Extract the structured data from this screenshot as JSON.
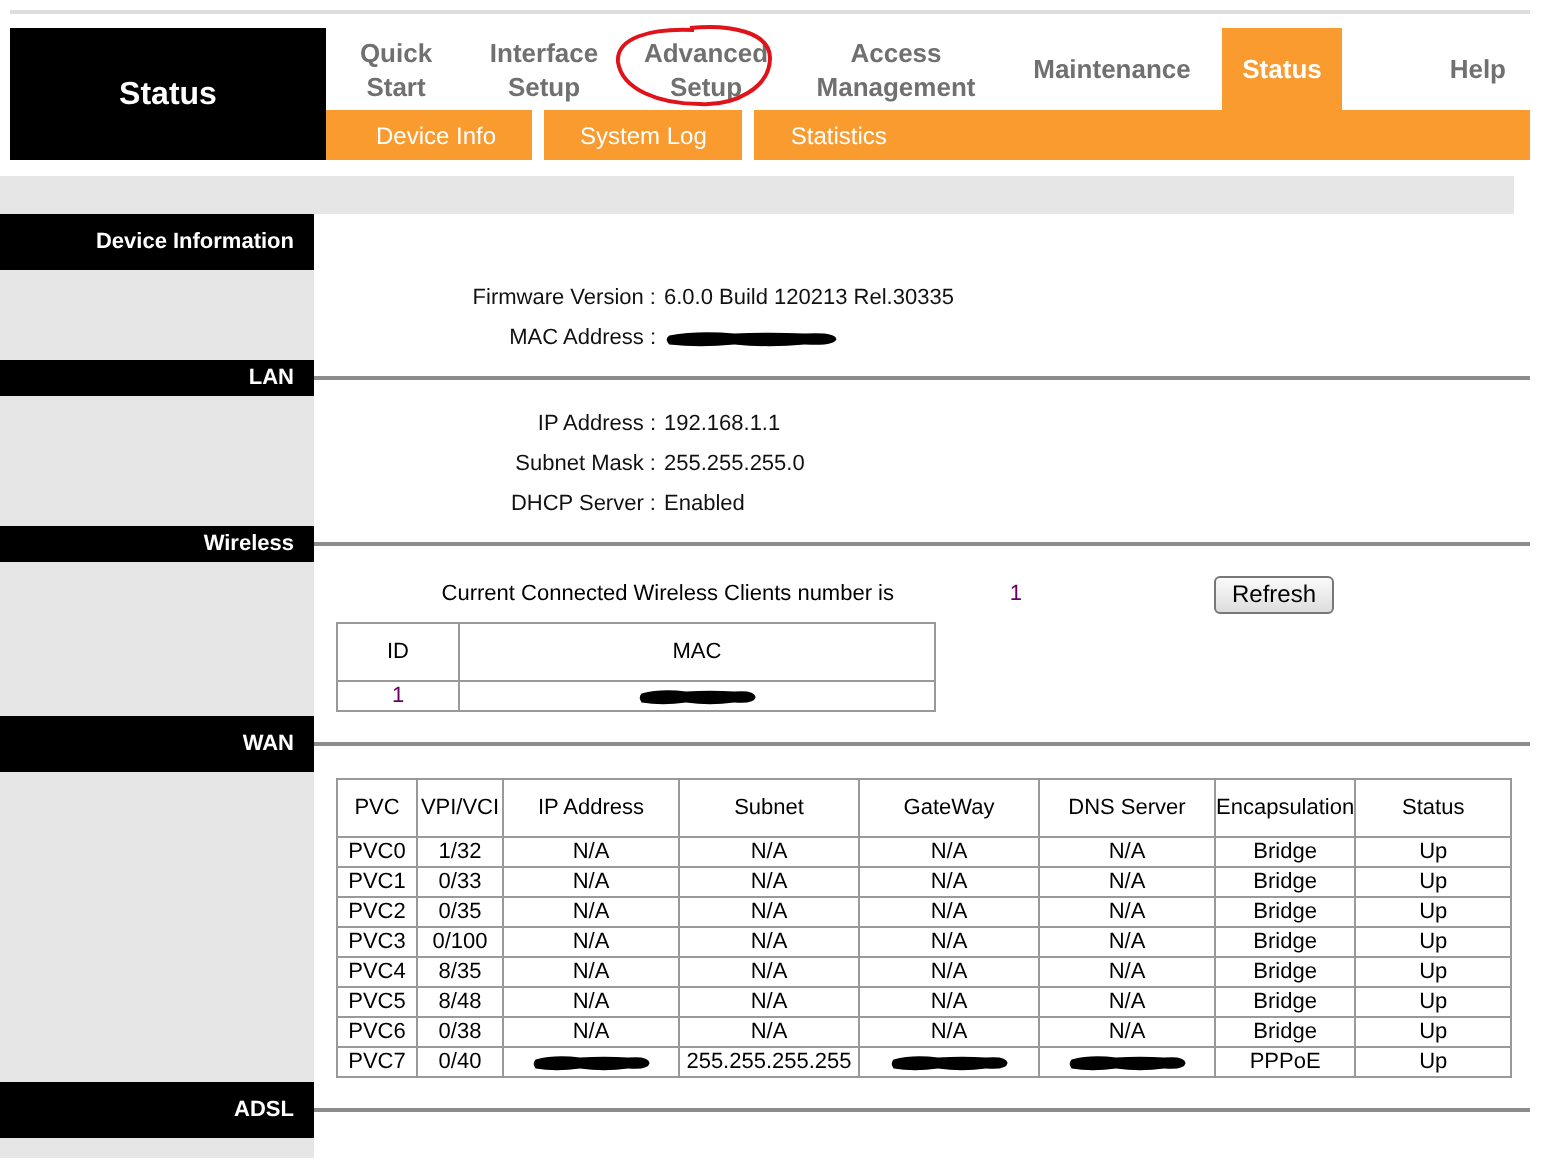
{
  "header": {
    "title": "Status",
    "nav": [
      {
        "label": "Quick Start",
        "selected": false,
        "annotated": false
      },
      {
        "label": "Interface Setup",
        "selected": false,
        "annotated": false
      },
      {
        "label": "Advanced Setup",
        "selected": false,
        "annotated": true
      },
      {
        "label": "Access Management",
        "selected": false,
        "annotated": false
      },
      {
        "label": "Maintenance",
        "selected": false,
        "annotated": false
      },
      {
        "label": "Status",
        "selected": true,
        "annotated": false
      },
      {
        "label": "Help",
        "selected": false,
        "annotated": false
      }
    ],
    "subnav": [
      {
        "label": "Device Info"
      },
      {
        "label": "System Log"
      },
      {
        "label": "Statistics"
      }
    ]
  },
  "sections": [
    {
      "title": "Device Information",
      "kind": "info",
      "rows": [
        {
          "label": "Firmware Version :",
          "value": "6.0.0 Build 120213 Rel.30335"
        },
        {
          "label": "MAC Address :",
          "redacted": true
        }
      ]
    },
    {
      "title": "LAN",
      "kind": "info",
      "rows": [
        {
          "label": "IP Address :",
          "value": "192.168.1.1"
        },
        {
          "label": "Subnet Mask :",
          "value": "255.255.255.0"
        },
        {
          "label": "DHCP Server :",
          "value": "Enabled"
        }
      ]
    },
    {
      "title": "Wireless",
      "kind": "clients",
      "caption": "Current Connected Wireless Clients number is",
      "count": "1",
      "button": "Refresh",
      "columns": [
        "ID",
        "MAC"
      ],
      "rows": [
        [
          {
            "text": "1"
          },
          {
            "redacted": true
          }
        ]
      ]
    },
    {
      "title": "WAN",
      "kind": "table",
      "columns": [
        "PVC",
        "VPI/VCI",
        "IP Address",
        "Subnet",
        "GateWay",
        "DNS Server",
        "Encapsulation",
        "Status"
      ],
      "rows": [
        [
          {
            "text": "PVC0"
          },
          {
            "text": "1/32"
          },
          {
            "text": "N/A"
          },
          {
            "text": "N/A"
          },
          {
            "text": "N/A"
          },
          {
            "text": "N/A"
          },
          {
            "text": "Bridge"
          },
          {
            "text": "Up"
          }
        ],
        [
          {
            "text": "PVC1"
          },
          {
            "text": "0/33"
          },
          {
            "text": "N/A"
          },
          {
            "text": "N/A"
          },
          {
            "text": "N/A"
          },
          {
            "text": "N/A"
          },
          {
            "text": "Bridge"
          },
          {
            "text": "Up"
          }
        ],
        [
          {
            "text": "PVC2"
          },
          {
            "text": "0/35"
          },
          {
            "text": "N/A"
          },
          {
            "text": "N/A"
          },
          {
            "text": "N/A"
          },
          {
            "text": "N/A"
          },
          {
            "text": "Bridge"
          },
          {
            "text": "Up"
          }
        ],
        [
          {
            "text": "PVC3"
          },
          {
            "text": "0/100"
          },
          {
            "text": "N/A"
          },
          {
            "text": "N/A"
          },
          {
            "text": "N/A"
          },
          {
            "text": "N/A"
          },
          {
            "text": "Bridge"
          },
          {
            "text": "Up"
          }
        ],
        [
          {
            "text": "PVC4"
          },
          {
            "text": "8/35"
          },
          {
            "text": "N/A"
          },
          {
            "text": "N/A"
          },
          {
            "text": "N/A"
          },
          {
            "text": "N/A"
          },
          {
            "text": "Bridge"
          },
          {
            "text": "Up"
          }
        ],
        [
          {
            "text": "PVC5"
          },
          {
            "text": "8/48"
          },
          {
            "text": "N/A"
          },
          {
            "text": "N/A"
          },
          {
            "text": "N/A"
          },
          {
            "text": "N/A"
          },
          {
            "text": "Bridge"
          },
          {
            "text": "Up"
          }
        ],
        [
          {
            "text": "PVC6"
          },
          {
            "text": "0/38"
          },
          {
            "text": "N/A"
          },
          {
            "text": "N/A"
          },
          {
            "text": "N/A"
          },
          {
            "text": "N/A"
          },
          {
            "text": "Bridge"
          },
          {
            "text": "Up"
          }
        ],
        [
          {
            "text": "PVC7"
          },
          {
            "text": "0/40"
          },
          {
            "redacted": true
          },
          {
            "text": "255.255.255.255"
          },
          {
            "redacted": true
          },
          {
            "redacted": true
          },
          {
            "text": "PPPoE"
          },
          {
            "text": "Up"
          }
        ]
      ]
    },
    {
      "title": "ADSL",
      "kind": "empty"
    }
  ]
}
